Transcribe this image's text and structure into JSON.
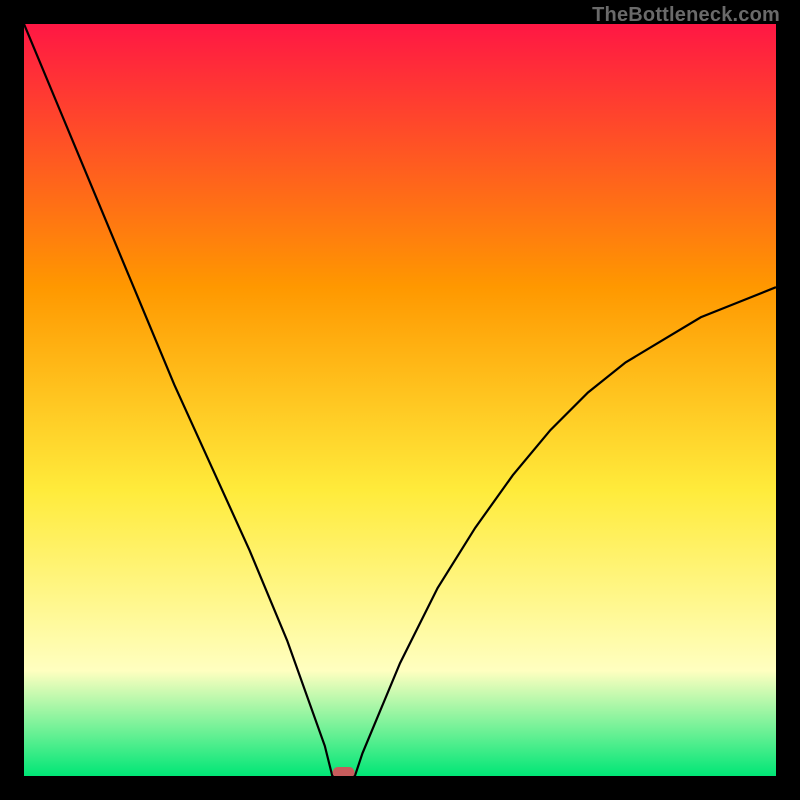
{
  "watermark": "TheBottleneck.com",
  "chart_data": {
    "type": "line",
    "title": "",
    "xlabel": "",
    "ylabel": "",
    "xlim": [
      0,
      100
    ],
    "ylim": [
      0,
      100
    ],
    "background_gradient": [
      "#ff1744",
      "#ff9800",
      "#ffeb3b",
      "#ffffc0",
      "#00e676"
    ],
    "marker": {
      "x": 42.5,
      "y": 0,
      "color": "#c75c5c"
    },
    "series": [
      {
        "name": "curve",
        "x": [
          0,
          5,
          10,
          15,
          20,
          25,
          30,
          35,
          40,
          41,
          42,
          43,
          44,
          45,
          50,
          55,
          60,
          65,
          70,
          75,
          80,
          85,
          90,
          95,
          100
        ],
        "values": [
          100,
          88,
          76,
          64,
          52,
          41,
          30,
          18,
          4,
          0,
          0,
          0,
          0,
          3,
          15,
          25,
          33,
          40,
          46,
          51,
          55,
          58,
          61,
          63,
          65
        ]
      }
    ]
  }
}
